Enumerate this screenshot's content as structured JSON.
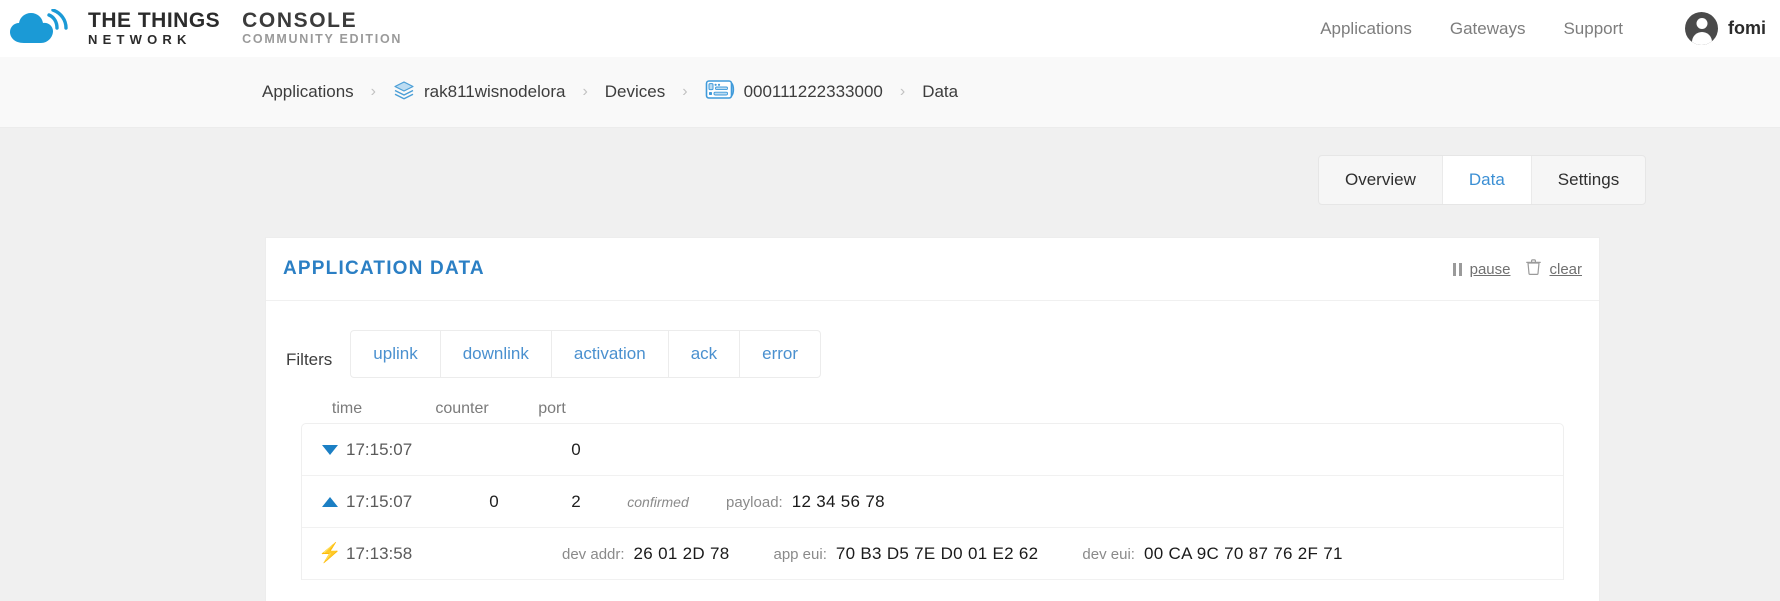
{
  "header": {
    "brand": {
      "logo_icon": "ttn-cloud-logo",
      "ttn_line1": "THE THINGS",
      "ttn_line2": "NETWORK",
      "console_line1": "CONSOLE",
      "console_line2": "COMMUNITY EDITION"
    },
    "nav": [
      {
        "label": "Applications"
      },
      {
        "label": "Gateways"
      },
      {
        "label": "Support"
      }
    ],
    "user": {
      "name": "fomi",
      "avatar_icon": "user-avatar-icon"
    }
  },
  "breadcrumb": {
    "items": [
      {
        "label": "Applications",
        "icon": null
      },
      {
        "label": "rak811wisnodelora",
        "icon": "layers-icon"
      },
      {
        "label": "Devices",
        "icon": null
      },
      {
        "label": "000111222333000",
        "icon": "device-board-icon"
      },
      {
        "label": "Data",
        "icon": null
      }
    ],
    "separator": "›"
  },
  "tabs": [
    {
      "label": "Overview",
      "active": false
    },
    {
      "label": "Data",
      "active": true
    },
    {
      "label": "Settings",
      "active": false
    }
  ],
  "panel": {
    "title": "APPLICATION DATA",
    "actions": [
      {
        "label": "pause",
        "icon": "pause-icon"
      },
      {
        "label": "clear",
        "icon": "trash-icon"
      }
    ],
    "filters": {
      "label": "Filters",
      "options": [
        "uplink",
        "downlink",
        "activation",
        "ack",
        "error"
      ]
    },
    "table": {
      "columns": [
        "time",
        "counter",
        "port"
      ],
      "rows": [
        {
          "type_icon": "downlink-triangle-icon",
          "time": "17:15:07",
          "counter": "",
          "port": "0",
          "flag": "",
          "fields": []
        },
        {
          "type_icon": "uplink-triangle-icon",
          "time": "17:15:07",
          "counter": "0",
          "port": "2",
          "flag": "confirmed",
          "fields": [
            {
              "key": "payload:",
              "value": "12 34 56 78"
            }
          ]
        },
        {
          "type_icon": "activation-bolt-icon",
          "time": "17:13:58",
          "counter": "",
          "port": "",
          "flag": "",
          "fields": [
            {
              "key": "dev addr:",
              "value": "26 01 2D 78"
            },
            {
              "key": "app eui:",
              "value": "70 B3 D5 7E D0 01 E2 62"
            },
            {
              "key": "dev eui:",
              "value": "00 CA 9C 70 87 76 2F 71"
            }
          ]
        }
      ]
    }
  },
  "colors": {
    "brand_blue": "#1b7fc4",
    "link_blue": "#4a90cf",
    "activation_yellow": "#f0c14b",
    "page_bg": "#f0f0f0"
  }
}
